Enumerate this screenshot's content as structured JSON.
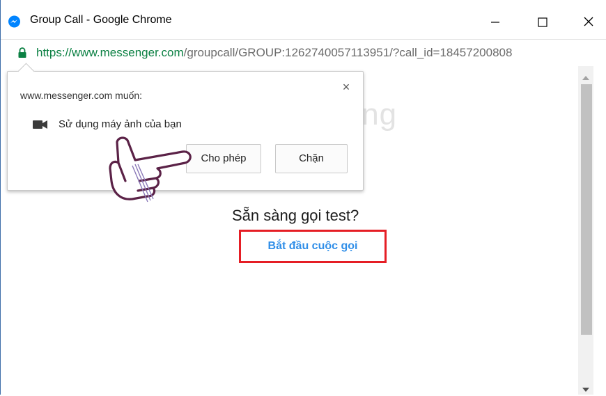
{
  "window": {
    "title": "Group Call - Google Chrome",
    "controls": {
      "minimize": "minimize",
      "maximize": "maximize",
      "close": "close"
    }
  },
  "address_bar": {
    "url_proto_host": "https://www.messenger.com",
    "url_path": "/groupcall/GROUP:1262740057113951/?call_id=18457200808"
  },
  "watermark": {
    "text": "uantrimang"
  },
  "permission_popup": {
    "origin_text": "www.messenger.com muốn:",
    "close_glyph": "×",
    "permission_text": "Sử dụng máy ảnh của bạn",
    "allow_label": "Cho phép",
    "block_label": "Chặn",
    "permission_icon": "camera-icon"
  },
  "call": {
    "ready_text": "Sẵn sàng gọi test?",
    "start_label": "Bắt đầu cuộc gọi"
  },
  "colors": {
    "highlight_border": "#e51e25",
    "link": "#2f8ee8",
    "secure_host": "#0b8043",
    "messenger_blue": "#0084ff"
  }
}
